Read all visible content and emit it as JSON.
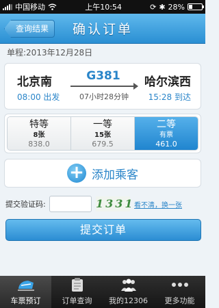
{
  "status_bar": {
    "carrier": "中国移动",
    "time": "上午10:54",
    "battery": "28%",
    "battery_level": 0.28
  },
  "nav": {
    "back_label": "查询结果",
    "title": "确认订单"
  },
  "trip": {
    "date_text": "单程:2013年12月28日",
    "from_station": "北京南",
    "to_station": "哈尔滨西",
    "train_number": "G381",
    "depart_text": "08:00 出发",
    "arrive_text": "15:28 到达",
    "duration": "07小时28分钟"
  },
  "seats": [
    {
      "name": "特等",
      "count": "8张",
      "price": "838.0",
      "selected": false
    },
    {
      "name": "一等",
      "count": "15张",
      "price": "679.5",
      "selected": false
    },
    {
      "name": "二等",
      "count": "有票",
      "price": "461.0",
      "selected": true
    }
  ],
  "passenger": {
    "add_label": "添加乘客"
  },
  "captcha": {
    "label": "提交验证码:",
    "input_value": "",
    "image_text": "1331",
    "refresh_label": "看不清，换一张"
  },
  "submit_label": "提交订单",
  "tabs": [
    {
      "label": "车票预订",
      "icon": "train-icon",
      "active": true
    },
    {
      "label": "订单查询",
      "icon": "clipboard-icon",
      "active": false
    },
    {
      "label": "我的12306",
      "icon": "people-icon",
      "active": false
    },
    {
      "label": "更多功能",
      "icon": "more-icon",
      "active": false
    }
  ],
  "colors": {
    "accent": "#2a85c9",
    "nav_top": "#5fb8ec",
    "nav_bottom": "#2a8fd3"
  }
}
